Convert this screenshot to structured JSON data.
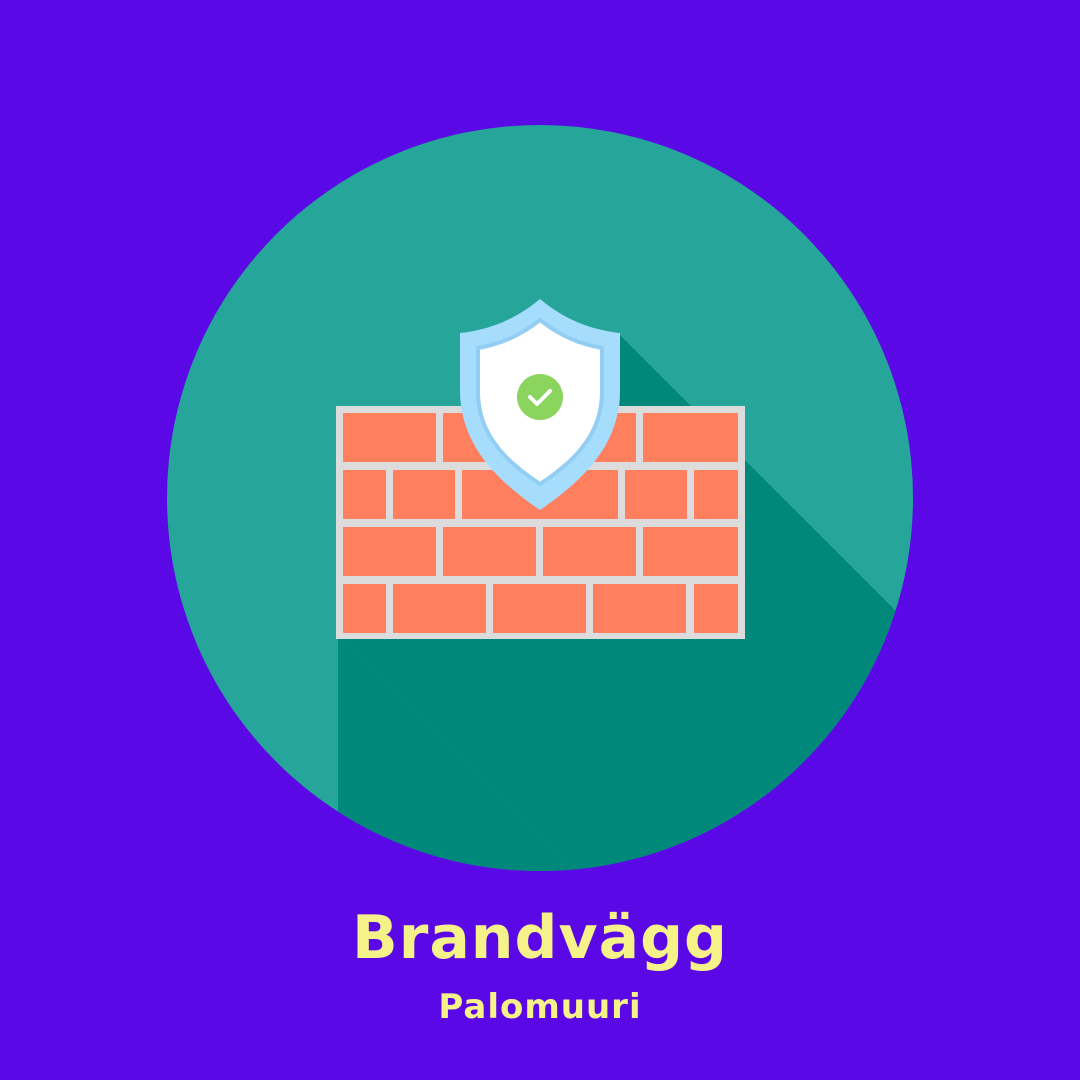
{
  "labels": {
    "title": "Brandvägg",
    "subtitle": "Palomuuri"
  },
  "icons": {
    "main": "firewall-icon",
    "shield": "shield-icon",
    "check": "check-icon"
  },
  "colors": {
    "background": "#5b08e6",
    "circle": "#26a69a",
    "shadow": "#00897b",
    "brick": "#ff7f5e",
    "mortar": "#dcdcdc",
    "shield_outer": "#a6dcfc",
    "shield_inner": "#ffffff",
    "check_circle": "#8bd45e",
    "text": "#f5f28a"
  }
}
